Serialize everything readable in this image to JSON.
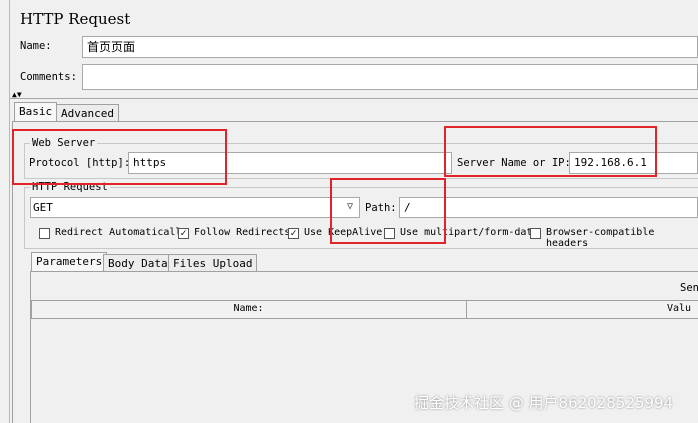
{
  "header": {
    "title": "HTTP Request"
  },
  "name_field": {
    "label": "Name:",
    "value": "首页页面"
  },
  "comments_field": {
    "label": "Comments:",
    "value": ""
  },
  "main_tabs": [
    {
      "label": "Basic"
    },
    {
      "label": "Advanced"
    }
  ],
  "web_server": {
    "group_label": "Web Server",
    "protocol_label": "Protocol [http]:",
    "protocol_value": "https",
    "server_label": "Server Name or IP:",
    "server_value": "192.168.6.1"
  },
  "http_request": {
    "group_label": "HTTP Request",
    "method": "GET",
    "path_label": "Path:",
    "path_value": "/"
  },
  "options": [
    {
      "label": "Redirect Automatically",
      "checked": false
    },
    {
      "label": "Follow Redirects",
      "checked": true
    },
    {
      "label": "Use KeepAlive",
      "checked": true
    },
    {
      "label": "Use multipart/form-data",
      "checked": false
    },
    {
      "label": "Browser-compatible headers",
      "checked": false
    }
  ],
  "sub_tabs": [
    {
      "label": "Parameters"
    },
    {
      "label": "Body Data"
    },
    {
      "label": "Files Upload"
    }
  ],
  "params": {
    "send_label": "Sen",
    "columns": [
      "Name:",
      "Valu"
    ]
  },
  "watermark": "掘金技术社区 @ 用户862028525994",
  "colors": {
    "highlight_border": "#e0242c",
    "background": "#f0f0f0"
  }
}
